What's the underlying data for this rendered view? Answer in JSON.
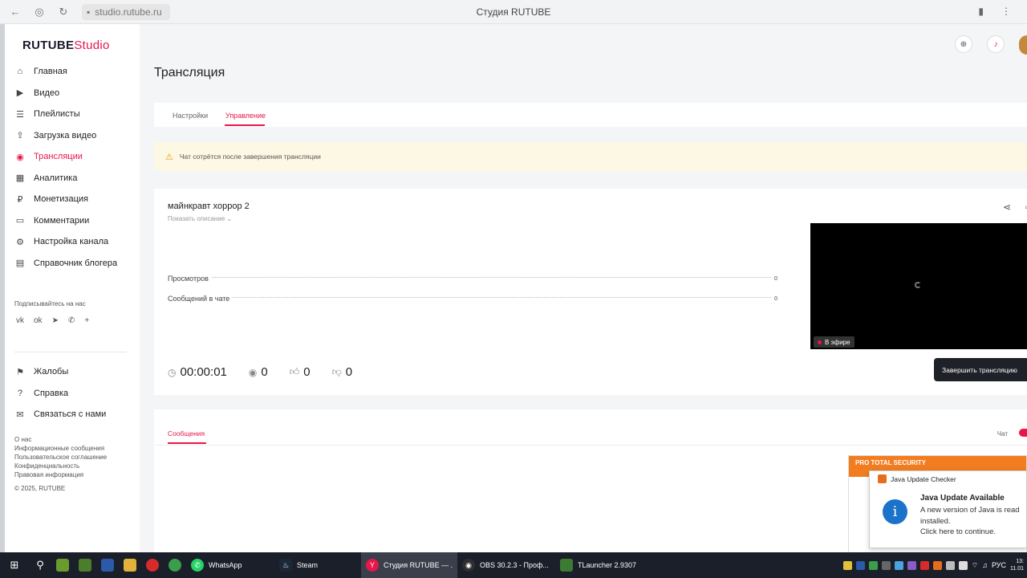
{
  "browser": {
    "url": "studio.rutube.ru",
    "page_title": "Студия RUTUBE"
  },
  "logo": {
    "main": "RUTUBE",
    "studio": "Studio"
  },
  "sidebar": {
    "items": [
      {
        "label": "Главная",
        "icon": "home-icon"
      },
      {
        "label": "Видео",
        "icon": "video-icon"
      },
      {
        "label": "Плейлисты",
        "icon": "playlist-icon"
      },
      {
        "label": "Загрузка видео",
        "icon": "upload-icon"
      },
      {
        "label": "Трансляции",
        "icon": "broadcast-icon",
        "active": true
      },
      {
        "label": "Аналитика",
        "icon": "analytics-icon"
      },
      {
        "label": "Монетизация",
        "icon": "monetization-icon"
      },
      {
        "label": "Комментарии",
        "icon": "comments-icon"
      },
      {
        "label": "Настройка канала",
        "icon": "channel-settings-icon"
      },
      {
        "label": "Справочник блогера",
        "icon": "handbook-icon"
      }
    ],
    "subscribe_label": "Подписывайтесь на нас",
    "items2": [
      {
        "label": "Жалобы",
        "icon": "flag-icon"
      },
      {
        "label": "Справка",
        "icon": "help-icon"
      },
      {
        "label": "Связаться с нами",
        "icon": "mail-icon"
      }
    ],
    "footer_links": [
      "О нас",
      "Информационные сообщения",
      "Пользовательское соглашение",
      "Конфиденциальность",
      "Правовая информация"
    ],
    "copyright": "© 2025, RUTUBE"
  },
  "main": {
    "title": "Трансляция",
    "tabs": [
      "Настройки",
      "Управление"
    ],
    "alert": "Чат сотрётся после завершения трансляции",
    "stream": {
      "title": "майнкравт хоррор 2",
      "show_description": "Показать описание",
      "stats": [
        {
          "label": "Просмотров",
          "value": "0"
        },
        {
          "label": "Сообщений в чате",
          "value": "0"
        }
      ],
      "timer": "00:00:01",
      "viewers": "0",
      "likes": "0",
      "dislikes": "0",
      "live_badge": "В эфире",
      "end_button": "Завершить трансляцию"
    },
    "messages_tab": "Сообщения",
    "chat_label": "Чат"
  },
  "notifications": {
    "back_header": "PRO TOTAL SECURITY",
    "front_app": "Java Update Checker",
    "front_title": "Java Update Available",
    "front_line1": "A new version of Java is read",
    "front_line2": "installed.",
    "front_line3": "Click here to continue."
  },
  "taskbar": {
    "apps": [
      {
        "label": "WhatsApp"
      },
      {
        "label": "Steam"
      },
      {
        "label": "Студия RUTUBE — ..."
      },
      {
        "label": "OBS 30.2.3 - Проф..."
      },
      {
        "label": "TLauncher 2.9307"
      }
    ],
    "lang": "РУС",
    "time": "13:",
    "date": "11.01"
  }
}
